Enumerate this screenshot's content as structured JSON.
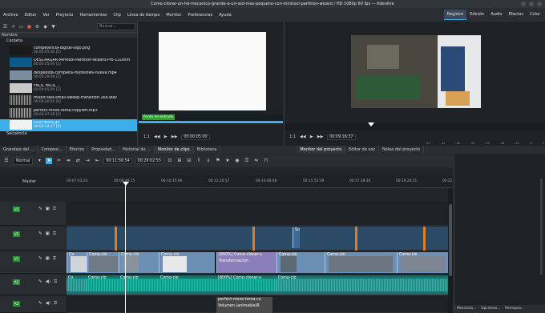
{
  "window": {
    "title": "Como-clonar-un-hd-mecanico-grande-a-un-ssd-mas-pequeno-con-minitool-partition-wizard / HD 1080p 60 fps — Kdenlive"
  },
  "menu": [
    "Archivo",
    "Editar",
    "Ver",
    "Proyecto",
    "Herramientas",
    "Clip",
    "Línea de tiempo",
    "Monitor",
    "Preferencias",
    "Ayuda"
  ],
  "layouts": [
    "Registro",
    "Edición",
    "Audio",
    "Efectos",
    "Color"
  ],
  "bin": {
    "search_placeholder": "Buscar...",
    "column_header": "Nombre",
    "folder": "Carpeta",
    "clips": [
      {
        "name": "competencia-digital-logo.png",
        "duration": "00:00:05:00 [5]"
      },
      {
        "name": "DESCARGAR-Minitool-Partition-Wizard-Pro-12Ultim",
        "duration": "00:00:05:00 [1]"
      },
      {
        "name": "despedida-completa-myfellows-nueva.mp4",
        "duration": "00:00:29:48 [2]"
      },
      {
        "name": "FÁCIL FÁCIL ...",
        "duration": "00:00:05:00 [2]"
      },
      {
        "name": "mixkit-fast-small-sweep-transition-166.wav",
        "duration": "00:00:00:50 [6]"
      },
      {
        "name": "perfect-move-tema-copyleft.mp3",
        "duration": "00:00:47:39 [3]"
      },
      {
        "name": "suscribeta.gif",
        "duration": "00:00:14:37 [4]"
      }
    ],
    "sequence": "Secuencia"
  },
  "clip_monitor": {
    "marker_label": "Punto de entrada",
    "zoom": "1:1",
    "timecode": "00:00:05:00"
  },
  "project_monitor": {
    "zoom": "1:1",
    "timecode": "00:09:16:37",
    "vu_ticks": [
      "-54",
      "-42",
      "-36",
      "-30",
      "-24",
      "-18",
      "-12",
      "-6",
      "0"
    ]
  },
  "tabs": [
    "Grandeja del ...",
    "Composi...",
    "Efectos",
    "Propiedad...",
    "Historial de ...",
    "Monitor de clips",
    "Biblioteca",
    "Monitor del proyecto",
    "Editor de voz",
    "Notas del proyecto"
  ],
  "timeline_toolbar": {
    "mode": "Normal",
    "timecode_current": "00:11:56:54",
    "timecode_total": "00:29:02:55"
  },
  "ruler": {
    "label": "Master",
    "ticks": [
      "00:07:03:24",
      "00:08:49:15",
      "00:10:35:06",
      "00:12:20:57",
      "00:14:06:48",
      "00:15:52:39",
      "00:17:38:30",
      "00:19:24:21",
      "00:21"
    ]
  },
  "tracks": [
    {
      "id": "V3",
      "type": "video"
    },
    {
      "id": "V2",
      "type": "video"
    },
    {
      "id": "V1",
      "type": "video"
    },
    {
      "id": "A1",
      "type": "audio"
    },
    {
      "id": "A2",
      "type": "audio"
    }
  ],
  "clips_labels": {
    "v1_short": "Co",
    "v1_main": "Como-clo",
    "v1_transform": "[800%] Como-clonar-u",
    "v1_transform2": "Transformación",
    "a1_main": "Como-clo",
    "a1_transform": "[800%] Como-clonar-u",
    "v2_short": "Su",
    "a2_music": "perfect-move-tema-co",
    "a2_volume": "Volumen (animable)R"
  },
  "right_tabs": [
    "Mezclado...",
    "Opciones...",
    "Remapeo..."
  ]
}
